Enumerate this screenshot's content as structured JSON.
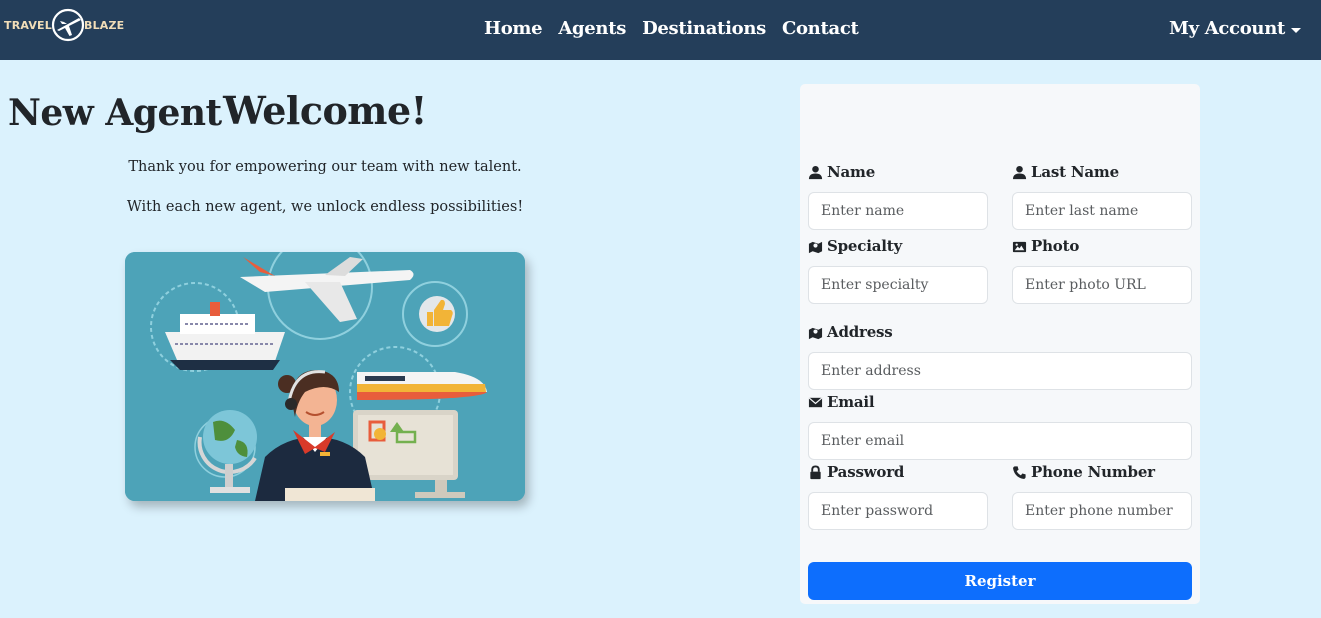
{
  "brand": {
    "left": "TRAVEL",
    "right": "BLAZE"
  },
  "nav": {
    "links": [
      "Home",
      "Agents",
      "Destinations",
      "Contact"
    ],
    "account": "My Account"
  },
  "welcome": {
    "title": "Welcome!",
    "line1": "Thank you for empowering our team with new talent.",
    "line2": "With each new agent, we unlock endless possibilities!"
  },
  "form": {
    "title": "New Agent",
    "fields": {
      "name": {
        "label": "Name",
        "placeholder": "Enter name"
      },
      "last_name": {
        "label": "Last Name",
        "placeholder": "Enter last name"
      },
      "specialty": {
        "label": "Specialty",
        "placeholder": "Enter specialty"
      },
      "photo": {
        "label": "Photo",
        "placeholder": "Enter photo URL"
      },
      "address": {
        "label": "Address",
        "placeholder": "Enter address"
      },
      "email": {
        "label": "Email",
        "placeholder": "Enter email"
      },
      "password": {
        "label": "Password",
        "placeholder": "Enter password"
      },
      "phone": {
        "label": "Phone Number",
        "placeholder": "Enter phone number"
      }
    },
    "submit": "Register"
  },
  "colors": {
    "navbar": "#243e5a",
    "page": "#dbf2fd",
    "primary": "#0d6efd",
    "brand_text": "#f1ddb8"
  },
  "icons": [
    "airplane-logo-icon",
    "person-icon",
    "map-icon",
    "image-icon",
    "envelope-icon",
    "lock-icon",
    "phone-icon",
    "caret-down-icon"
  ]
}
